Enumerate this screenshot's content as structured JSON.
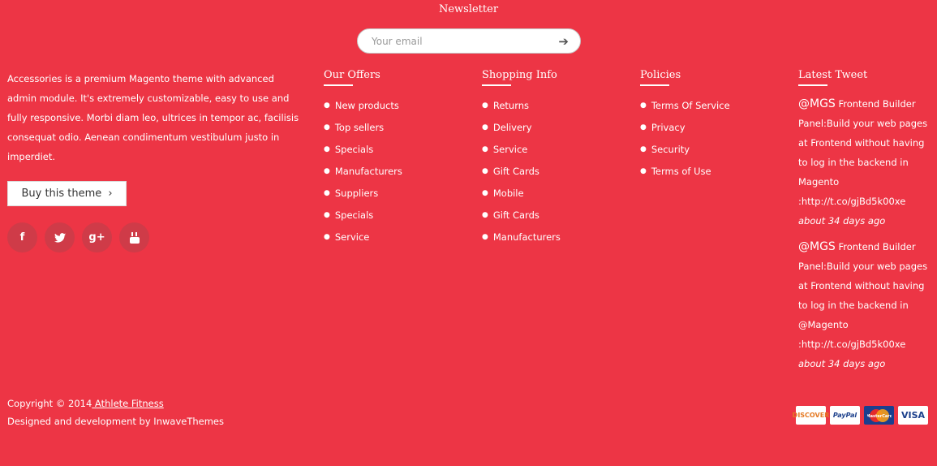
{
  "newsletter": {
    "title": "Newsletter",
    "placeholder": "Your email",
    "submit_icon": "arrow-right-icon"
  },
  "about": {
    "text": "Accessories is a premium Magento theme with advanced admin module. It's extremely customizable, easy to use and fully responsive. Morbi diam leo, ultrices in tempor ac, facilisis consequat odio. Aenean condimentum vestibulum justo in imperdiet.",
    "buy_label": "Buy this theme"
  },
  "social": [
    "f",
    "t",
    "g+",
    "yt"
  ],
  "columns": [
    {
      "title": "Our Offers",
      "items": [
        "New products",
        "Top sellers",
        "Specials",
        "Manufacturers",
        "Suppliers",
        "Specials",
        "Service"
      ]
    },
    {
      "title": "Shopping Info",
      "items": [
        "Returns",
        "Delivery",
        "Service",
        "Gift Cards",
        "Mobile",
        "Gift Cards",
        "Manufacturers"
      ]
    },
    {
      "title": "Policies",
      "items": [
        "Terms Of Service",
        "Privacy",
        "Security",
        "Terms of Use"
      ]
    }
  ],
  "tweets": {
    "title": "Latest Tweet",
    "items": [
      {
        "handle": "@MGS",
        "text": "Frontend Builder Panel:Build your web pages at Frontend without having to log in the backend in Magento :http://t.co/gjBd5k00xe",
        "time": "about 34 days ago"
      },
      {
        "handle": "@MGS",
        "text": "Frontend Builder Panel:Build your web pages at Frontend without having to log in the backend in @Magento :http://t.co/gjBd5k00xe",
        "time": "about 34 days ago"
      }
    ]
  },
  "footer": {
    "copyright": "Copyright © 2014",
    "brand": " Athlete Fitness",
    "designed": "Designed and development by InwaveThemes"
  },
  "payments": [
    "DISCOVER",
    "PayPal",
    "MasterCard",
    "VISA"
  ]
}
